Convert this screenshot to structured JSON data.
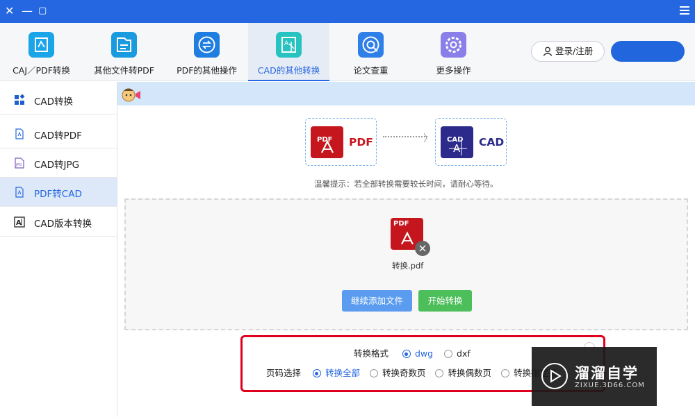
{
  "window_controls": {
    "close": "✕",
    "minimize": "—",
    "maximize": "▢"
  },
  "toolbar": {
    "tabs": [
      {
        "label": "CAJ／PDF转换",
        "icon": "caj-pdf-icon",
        "color": "#1aa5e8"
      },
      {
        "label": "其他文件转PDF",
        "icon": "file-to-pdf-icon",
        "color": "#1a9be0"
      },
      {
        "label": "PDF的其他操作",
        "icon": "pdf-ops-icon",
        "color": "#1f7ee0"
      },
      {
        "label": "CAD的其他转换",
        "icon": "cad-convert-icon",
        "color": "#26c3c0"
      },
      {
        "label": "论文查重",
        "icon": "paper-check-icon",
        "color": "#2f7fe8"
      },
      {
        "label": "更多操作",
        "icon": "more-ops-icon",
        "color": "#8a7ee8"
      }
    ],
    "active_tab": "CAD的其他转换",
    "login_label": "登录/注册",
    "accent_color": "#2567e0"
  },
  "sidebar": {
    "items": [
      {
        "label": "CAD转换",
        "icon": "grid-icon"
      },
      {
        "label": "CAD转PDF",
        "icon": "pdf-doc-icon"
      },
      {
        "label": "CAD转JPG",
        "icon": "jpg-doc-icon"
      },
      {
        "label": "PDF转CAD",
        "icon": "pdf-doc-icon"
      },
      {
        "label": "CAD版本转换",
        "icon": "cad-version-icon"
      }
    ],
    "active": "PDF转CAD"
  },
  "conversion": {
    "from_label": "PDF",
    "from_icon_text": "PDF",
    "to_label": "CAD",
    "to_icon_text": "CAD",
    "tip": "温馨提示：若全部转换需要较长时间，请耐心等待。"
  },
  "file": {
    "name": "转换.pdf",
    "icon_text": "PDF"
  },
  "buttons": {
    "add": "继续添加文件",
    "start": "开始转换"
  },
  "options": {
    "format_label": "转换格式",
    "formats": [
      {
        "label": "dwg",
        "selected": true
      },
      {
        "label": "dxf",
        "selected": false
      }
    ],
    "page_label": "页码选择",
    "pages": [
      {
        "label": "转换全部",
        "selected": true
      },
      {
        "label": "转换奇数页",
        "selected": false
      },
      {
        "label": "转换偶数页",
        "selected": false
      },
      {
        "label": "转换指定页",
        "selected": false
      }
    ]
  },
  "watermark": {
    "title": "溜溜自学",
    "url": "ZIXUE.3D66.COM"
  }
}
